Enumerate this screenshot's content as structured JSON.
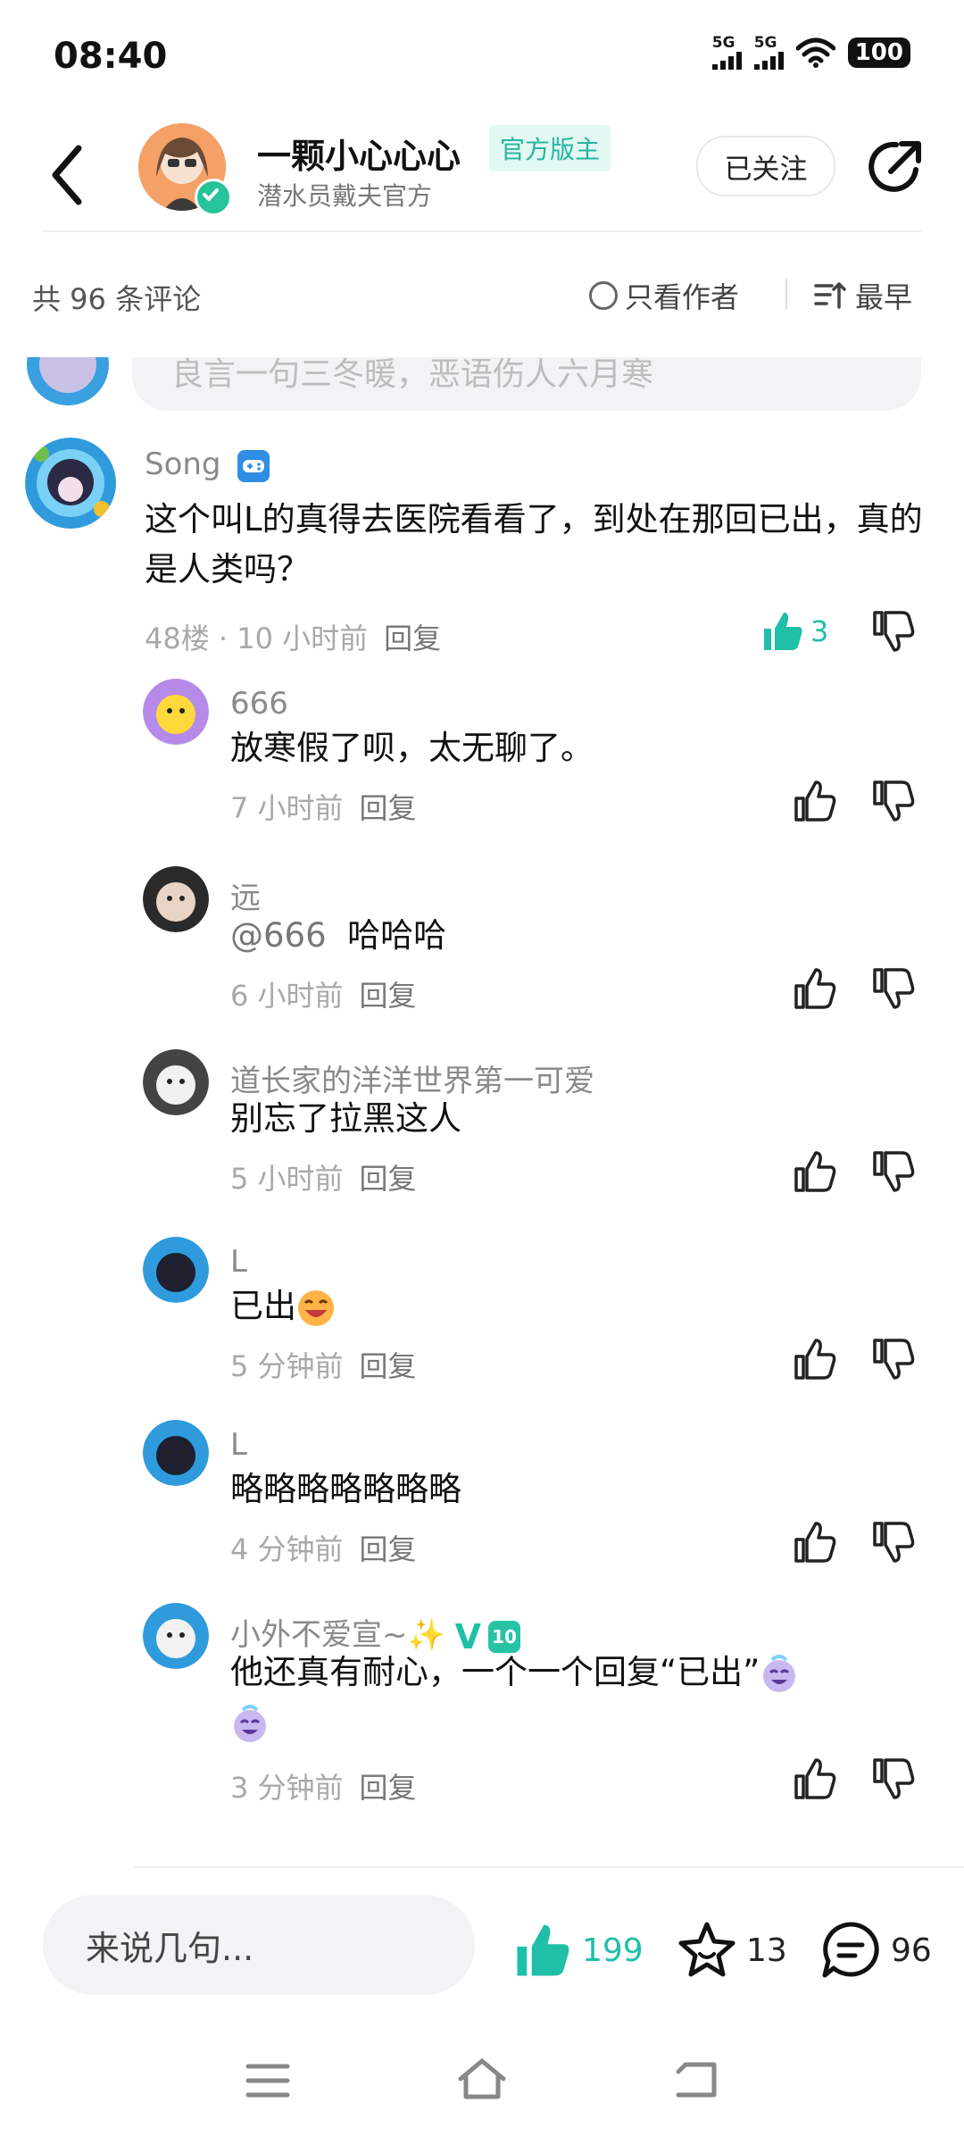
{
  "status_bar": {
    "time": "08:40",
    "network1": "5G",
    "network2": "5G",
    "battery": "100"
  },
  "header": {
    "name": "一颗小心心心",
    "badge": "官方版主",
    "subtitle": "潜水员戴夫官方",
    "follow_label": "已关注"
  },
  "filter": {
    "count": "共 96 条评论",
    "only_author": "只看作者",
    "sort": "最早"
  },
  "partial_comment": "良言一句三冬暖，恶语伤人六月寒",
  "main_comment": {
    "name": "Song",
    "text": "这个叫L的真得去医院看看了，到处在那回已出，真的是人类吗？",
    "floor": "48楼 · 10 小时前",
    "reply": "回复",
    "likes": "3"
  },
  "replies": [
    {
      "name": "666",
      "text": "放寒假了呗，太无聊了。",
      "time": "7 小时前",
      "reply": "回复"
    },
    {
      "name": "远",
      "mention": "@666",
      "text": "哈哈哈",
      "time": "6 小时前",
      "reply": "回复"
    },
    {
      "name": "道长家的洋洋世界第一可爱",
      "text": "别忘了拉黑这人",
      "time": "5 小时前",
      "reply": "回复"
    },
    {
      "name": "L",
      "text": "已出",
      "time": "5 分钟前",
      "reply": "回复"
    },
    {
      "name": "L",
      "text": "略略略略略略略",
      "time": "4 分钟前",
      "reply": "回复"
    },
    {
      "name": "小外不爱宣~✨",
      "badge_v": "V",
      "badge_level": "10",
      "text": "他还真有耐心，一个一个回复“已出”",
      "time": "3 分钟前",
      "reply": "回复"
    }
  ],
  "bottom": {
    "input_placeholder": "来说几句...",
    "likes": "199",
    "stars": "13",
    "comments": "96"
  },
  "colors": {
    "accent": "#1fbfa8",
    "badge_bg": "#e2f8f3"
  }
}
